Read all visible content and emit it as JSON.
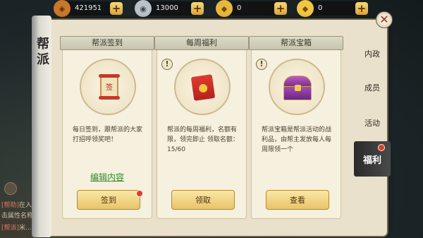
{
  "currencies": [
    {
      "name": "copper-coin",
      "value": "421951",
      "icon_glyph": "◈",
      "color": "#c9782b"
    },
    {
      "name": "silver-ingot",
      "value": "13000",
      "icon_glyph": "◉",
      "color": "#b9c2c8"
    },
    {
      "name": "gold-ingot-bound",
      "value": "0",
      "icon_glyph": "◆",
      "color": "#e8b83a"
    },
    {
      "name": "gold-ingot",
      "value": "0",
      "icon_glyph": "◆",
      "color": "#f2c542"
    }
  ],
  "plus_label": "+",
  "panel": {
    "title": "帮派"
  },
  "close_label": "✕",
  "cards": [
    {
      "header": "帮派签到",
      "desc": "每日签到，跟帮派的大家打招呼领奖吧！",
      "link": "编辑内容",
      "button": "签到",
      "has_warning": false,
      "has_red_dot": true
    },
    {
      "header": "每周福利",
      "desc": "帮派的每周福利，名额有限，领完即止 领取名额：15/60",
      "button": "领取",
      "has_warning": true
    },
    {
      "header": "帮派宝箱",
      "desc": "帮派宝箱是帮派活动的战利品，由帮主发放每人每周限领一个",
      "button": "查看",
      "has_warning": true
    }
  ],
  "warning_glyph": "!",
  "tabs": [
    {
      "label": "内政",
      "active": false
    },
    {
      "label": "成员",
      "active": false
    },
    {
      "label": "活动",
      "active": false
    },
    {
      "label": "福利",
      "active": true
    }
  ],
  "chat": [
    {
      "tag": "[帮助]",
      "text": "在入..."
    },
    {
      "tag": "",
      "text": "击属性名称"
    },
    {
      "tag": "[帮派]",
      "text": "米..."
    }
  ],
  "colors": {
    "accent_gold": "#e8c46a",
    "link_green": "#2f8a2a",
    "alert_red": "#e23b2a"
  }
}
